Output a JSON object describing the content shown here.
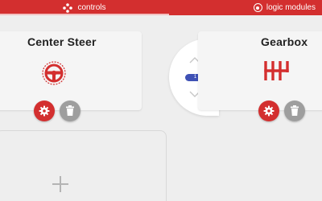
{
  "tabs": [
    {
      "label": "controls",
      "icon": "dpad-icon",
      "active": true
    },
    {
      "label": "logic modules",
      "icon": "logic-icon",
      "active": false
    }
  ],
  "modules": [
    {
      "title": "Center Steer",
      "icon": "steering-wheel-icon"
    },
    {
      "title": "Gearbox",
      "icon": "gearshift-icon"
    }
  ],
  "pager": {
    "current": "1"
  },
  "add_slot": {
    "icon": "plus-icon"
  },
  "colors": {
    "accent_red": "#d32f2f",
    "indicator_blue": "#3f51b5",
    "button_grey": "#9e9e9e",
    "background": "#eeeeee"
  }
}
